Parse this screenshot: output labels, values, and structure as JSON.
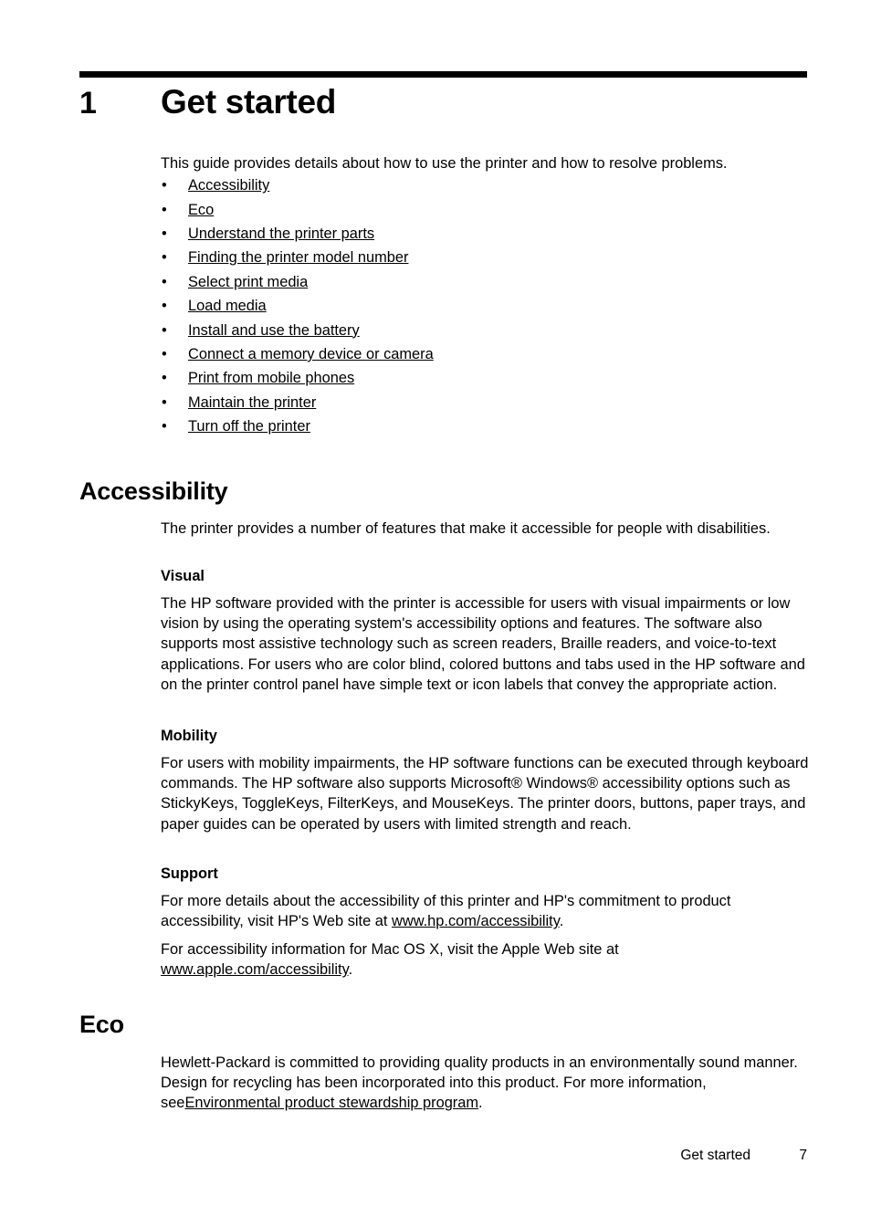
{
  "chapter": {
    "number": "1",
    "title": "Get started",
    "intro": "This guide provides details about how to use the printer and how to resolve problems.",
    "bullet_glyph": "•",
    "toc": [
      "Accessibility",
      "Eco",
      "Understand the printer parts",
      "Finding the printer model number",
      "Select print media",
      "Load media",
      "Install and use the battery",
      "Connect a memory device or camera",
      "Print from mobile phones",
      "Maintain the printer",
      "Turn off the printer"
    ]
  },
  "accessibility": {
    "heading": "Accessibility",
    "intro": "The printer provides a number of features that make it accessible for people with disabilities.",
    "visual": {
      "heading": "Visual",
      "text": "The HP software provided with the printer is accessible for users with visual impairments or low vision by using the operating system's accessibility options and features. The software also supports most assistive technology such as screen readers, Braille readers, and voice-to-text applications. For users who are color blind, colored buttons and tabs used in the HP software and on the printer control panel have simple text or icon labels that convey the appropriate action."
    },
    "mobility": {
      "heading": "Mobility",
      "text": "For users with mobility impairments, the HP software functions can be executed through keyboard commands. The HP software also supports Microsoft® Windows® accessibility options such as StickyKeys, ToggleKeys, FilterKeys, and MouseKeys. The printer doors, buttons, paper trays, and paper guides can be operated by users with limited strength and reach."
    },
    "support": {
      "heading": "Support",
      "para1_before": "For more details about the accessibility of this printer and HP's commitment to product accessibility, visit HP's Web site at ",
      "para1_link": "www.hp.com/accessibility",
      "para1_after": ".",
      "para2_before": "For accessibility information for Mac OS X, visit the Apple Web site at ",
      "para2_link": "www.apple.com/accessibility",
      "para2_after": "."
    }
  },
  "eco": {
    "heading": "Eco",
    "para_before": "Hewlett-Packard is committed to providing quality products in an environmentally sound manner. Design for recycling has been incorporated into this product. For more information, see",
    "para_link": "Environmental product stewardship program",
    "para_after": "."
  },
  "footer": {
    "chapter_label": "Get started",
    "page_number": "7"
  }
}
